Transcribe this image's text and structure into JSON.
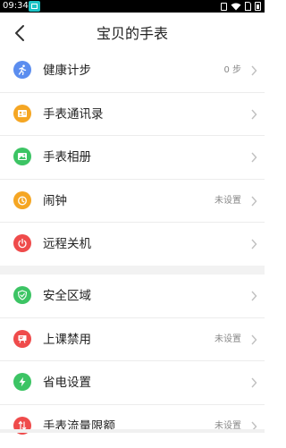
{
  "status_bar": {
    "time": "09:34"
  },
  "header": {
    "title": "宝贝的手表"
  },
  "group1": [
    {
      "label": "健康计步",
      "value": "0 步",
      "icon": "run-icon",
      "color": "#5b8def"
    },
    {
      "label": "手表通讯录",
      "value": "",
      "icon": "contacts-icon",
      "color": "#f5a623"
    },
    {
      "label": "手表相册",
      "value": "",
      "icon": "photo-icon",
      "color": "#3cc464"
    },
    {
      "label": "闹钟",
      "value": "未设置",
      "icon": "alarm-icon",
      "color": "#f5a623"
    },
    {
      "label": "远程关机",
      "value": "",
      "icon": "power-icon",
      "color": "#ef4b4b"
    }
  ],
  "group2": [
    {
      "label": "安全区域",
      "value": "",
      "icon": "shield-icon",
      "color": "#3cc464"
    },
    {
      "label": "上课禁用",
      "value": "未设置",
      "icon": "class-ban-icon",
      "color": "#ef4b4b"
    },
    {
      "label": "省电设置",
      "value": "",
      "icon": "bolt-icon",
      "color": "#3cc464"
    },
    {
      "label": "手表流量限额",
      "value": "未设置",
      "icon": "data-limit-icon",
      "color": "#ef4b4b"
    }
  ]
}
